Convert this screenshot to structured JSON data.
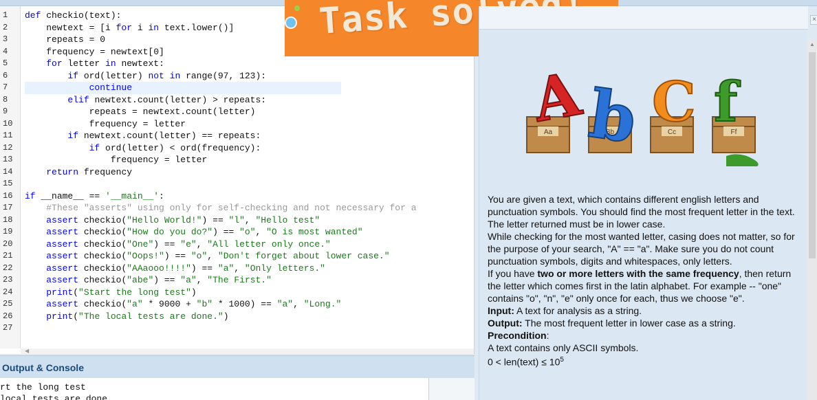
{
  "editor": {
    "lines": [
      {
        "n": "1",
        "tokens": [
          [
            "kw",
            "def"
          ],
          [
            "t",
            " checkio(text):"
          ]
        ]
      },
      {
        "n": "2",
        "tokens": [
          [
            "t",
            "    newtext = [i "
          ],
          [
            "kw",
            "for"
          ],
          [
            "t",
            " i "
          ],
          [
            "kw",
            "in"
          ],
          [
            "t",
            " text.lower()]"
          ]
        ]
      },
      {
        "n": "3",
        "tokens": [
          [
            "t",
            "    repeats = 0"
          ]
        ]
      },
      {
        "n": "4",
        "tokens": [
          [
            "t",
            "    frequency = newtext[0]"
          ]
        ]
      },
      {
        "n": "5",
        "tokens": [
          [
            "t",
            "    "
          ],
          [
            "kw",
            "for"
          ],
          [
            "t",
            " letter "
          ],
          [
            "kw",
            "in"
          ],
          [
            "t",
            " newtext:"
          ]
        ]
      },
      {
        "n": "6",
        "tokens": [
          [
            "t",
            "        "
          ],
          [
            "kw",
            "if"
          ],
          [
            "t",
            " ord(letter) "
          ],
          [
            "kw",
            "not in"
          ],
          [
            "t",
            " range(97, 123):"
          ]
        ]
      },
      {
        "n": "7",
        "tokens": [
          [
            "t",
            "            "
          ],
          [
            "kw",
            "continue"
          ]
        ]
      },
      {
        "n": "8",
        "tokens": [
          [
            "t",
            "        "
          ],
          [
            "kw",
            "elif"
          ],
          [
            "t",
            " newtext.count(letter) > repeats:"
          ]
        ]
      },
      {
        "n": "9",
        "tokens": [
          [
            "t",
            "            repeats = newtext.count(letter)"
          ]
        ]
      },
      {
        "n": "10",
        "tokens": [
          [
            "t",
            "            frequency = letter"
          ]
        ]
      },
      {
        "n": "11",
        "tokens": [
          [
            "t",
            "        "
          ],
          [
            "kw",
            "if"
          ],
          [
            "t",
            " newtext.count(letter) == repeats:"
          ]
        ]
      },
      {
        "n": "12",
        "tokens": [
          [
            "t",
            "            "
          ],
          [
            "kw",
            "if"
          ],
          [
            "t",
            " ord(letter) < ord(frequency):"
          ]
        ]
      },
      {
        "n": "13",
        "tokens": [
          [
            "t",
            "                frequency = letter"
          ]
        ]
      },
      {
        "n": "14",
        "tokens": [
          [
            "t",
            "    "
          ],
          [
            "kw",
            "return"
          ],
          [
            "t",
            " frequency"
          ]
        ]
      },
      {
        "n": "15",
        "tokens": [
          [
            "t",
            ""
          ]
        ]
      },
      {
        "n": "16",
        "tokens": [
          [
            "kw",
            "if"
          ],
          [
            "t",
            " __name__ == "
          ],
          [
            "str",
            "'__main__'"
          ],
          [
            "t",
            ":"
          ]
        ]
      },
      {
        "n": "17",
        "tokens": [
          [
            "t",
            "    "
          ],
          [
            "cmt",
            "#These \"asserts\" using only for self-checking and not necessary for a"
          ]
        ]
      },
      {
        "n": "18",
        "tokens": [
          [
            "t",
            "    "
          ],
          [
            "kw",
            "assert"
          ],
          [
            "t",
            " checkio("
          ],
          [
            "str",
            "\"Hello World!\""
          ],
          [
            "t",
            ") == "
          ],
          [
            "str",
            "\"l\""
          ],
          [
            "t",
            ", "
          ],
          [
            "str",
            "\"Hello test\""
          ]
        ]
      },
      {
        "n": "19",
        "tokens": [
          [
            "t",
            "    "
          ],
          [
            "kw",
            "assert"
          ],
          [
            "t",
            " checkio("
          ],
          [
            "str",
            "\"How do you do?\""
          ],
          [
            "t",
            ") == "
          ],
          [
            "str",
            "\"o\""
          ],
          [
            "t",
            ", "
          ],
          [
            "str",
            "\"O is most wanted\""
          ]
        ]
      },
      {
        "n": "20",
        "tokens": [
          [
            "t",
            "    "
          ],
          [
            "kw",
            "assert"
          ],
          [
            "t",
            " checkio("
          ],
          [
            "str",
            "\"One\""
          ],
          [
            "t",
            ") == "
          ],
          [
            "str",
            "\"e\""
          ],
          [
            "t",
            ", "
          ],
          [
            "str",
            "\"All letter only once.\""
          ]
        ]
      },
      {
        "n": "21",
        "tokens": [
          [
            "t",
            "    "
          ],
          [
            "kw",
            "assert"
          ],
          [
            "t",
            " checkio("
          ],
          [
            "str",
            "\"Oops!\""
          ],
          [
            "t",
            ") == "
          ],
          [
            "str",
            "\"o\""
          ],
          [
            "t",
            ", "
          ],
          [
            "str",
            "\"Don't forget about lower case.\""
          ]
        ]
      },
      {
        "n": "22",
        "tokens": [
          [
            "t",
            "    "
          ],
          [
            "kw",
            "assert"
          ],
          [
            "t",
            " checkio("
          ],
          [
            "str",
            "\"AAaooo!!!!\""
          ],
          [
            "t",
            ") == "
          ],
          [
            "str",
            "\"a\""
          ],
          [
            "t",
            ", "
          ],
          [
            "str",
            "\"Only letters.\""
          ]
        ]
      },
      {
        "n": "23",
        "tokens": [
          [
            "t",
            "    "
          ],
          [
            "kw",
            "assert"
          ],
          [
            "t",
            " checkio("
          ],
          [
            "str",
            "\"abe\""
          ],
          [
            "t",
            ") == "
          ],
          [
            "str",
            "\"a\""
          ],
          [
            "t",
            ", "
          ],
          [
            "str",
            "\"The First.\""
          ]
        ]
      },
      {
        "n": "24",
        "tokens": [
          [
            "t",
            "    "
          ],
          [
            "kw",
            "print"
          ],
          [
            "t",
            "("
          ],
          [
            "str",
            "\"Start the long test\""
          ],
          [
            "t",
            ")"
          ]
        ]
      },
      {
        "n": "25",
        "tokens": [
          [
            "t",
            "    "
          ],
          [
            "kw",
            "assert"
          ],
          [
            "t",
            " checkio("
          ],
          [
            "str",
            "\"a\""
          ],
          [
            "t",
            " * 9000 + "
          ],
          [
            "str",
            "\"b\""
          ],
          [
            "t",
            " * 1000) == "
          ],
          [
            "str",
            "\"a\""
          ],
          [
            "t",
            ", "
          ],
          [
            "str",
            "\"Long.\""
          ]
        ]
      },
      {
        "n": "26",
        "tokens": [
          [
            "t",
            "    "
          ],
          [
            "kw",
            "print"
          ],
          [
            "t",
            "("
          ],
          [
            "str",
            "\"The local tests are done.\""
          ],
          [
            "t",
            ")"
          ]
        ]
      },
      {
        "n": "27",
        "tokens": [
          [
            "t",
            ""
          ]
        ]
      }
    ],
    "highlighted_line": 7
  },
  "banner": {
    "text": "Task solved!",
    "color": "#f5862a"
  },
  "close_label": "×",
  "illustration": {
    "letters": [
      "A",
      "b",
      "C",
      "f"
    ],
    "crate_labels": [
      "Aa",
      "Bb",
      "Cc",
      "Ff"
    ]
  },
  "description": {
    "p1": "You are given a text, which contains different english letters and punctuation symbols. You should find the most frequent letter in the text. The letter returned must be in lower case.",
    "p2": "While checking for the most wanted letter, casing does not matter, so for the purpose of your search, \"A\" == \"a\". Make sure you do not count punctuation symbols, digits and whitespaces, only letters.",
    "p3_pre": "If you have ",
    "p3_bold": "two or more letters with the same frequency",
    "p3_post": ", then return the letter which comes first in the latin alphabet. For example -- \"one\" contains \"o\", \"n\", \"e\" only once for each, thus we choose \"e\".",
    "input_label": "Input:",
    "input_text": " A text for analysis as a string.",
    "output_label": "Output:",
    "output_text": " The most frequent letter in lower case as a string.",
    "precondition_label": "Precondition",
    "precondition_colon": ":",
    "pre1": "A text contains only ASCII symbols.",
    "pre2_base": "0 < len(text) ≤ 10",
    "pre2_sup": "5"
  },
  "output": {
    "title": "Output & Console",
    "lines": [
      "rt the long test",
      "local tests are done"
    ]
  }
}
